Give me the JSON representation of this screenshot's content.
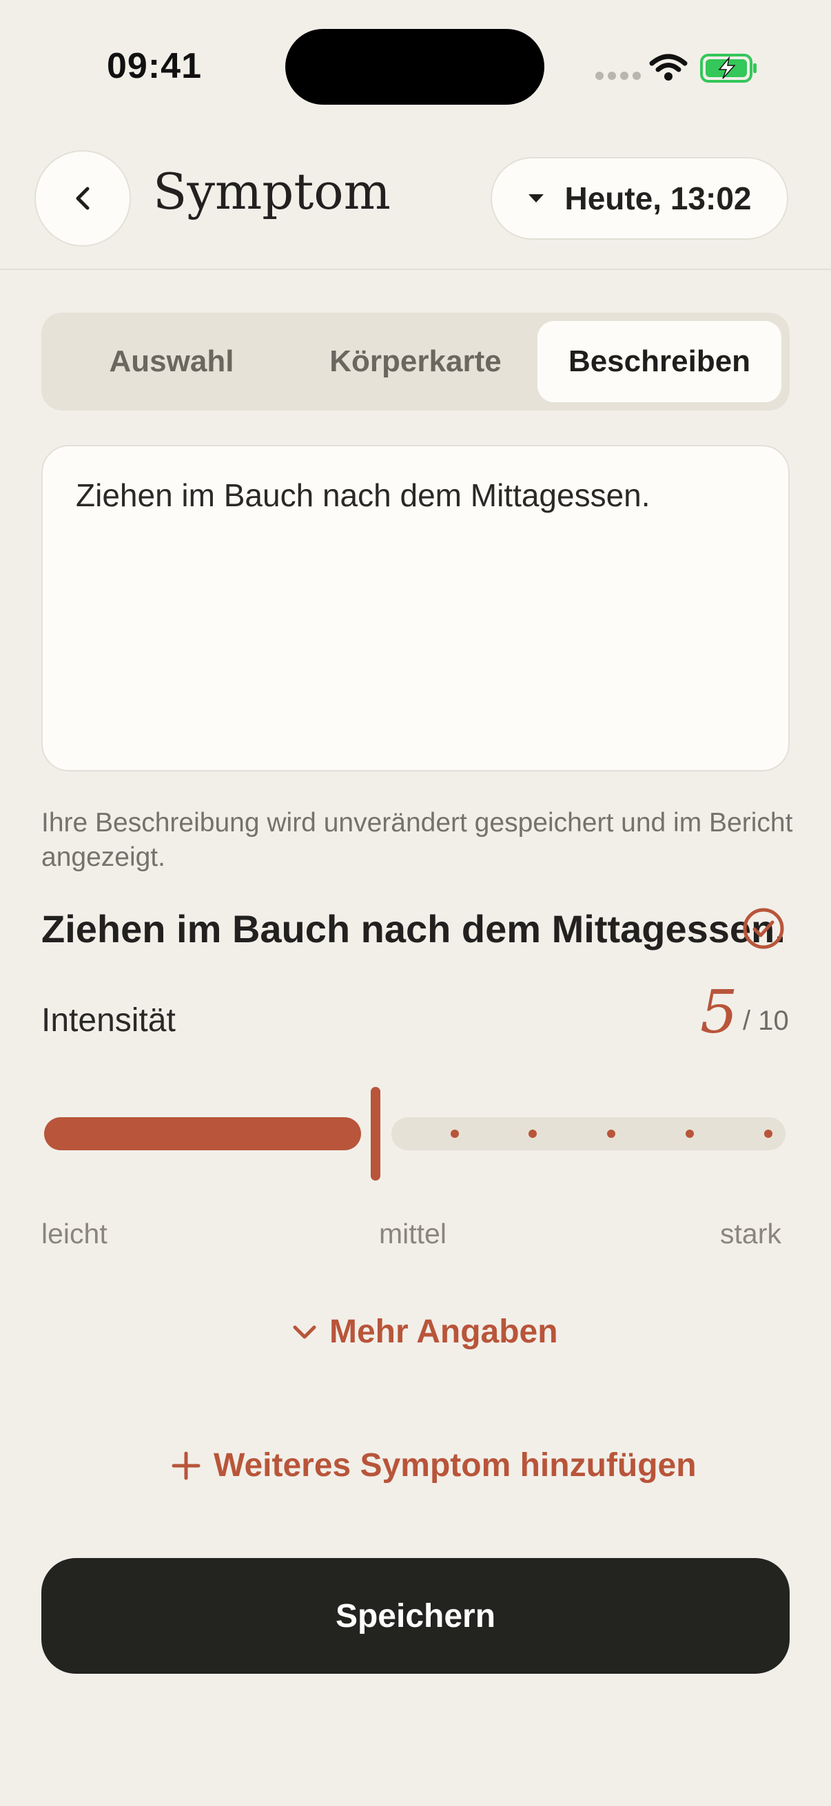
{
  "status_bar": {
    "time": "09:41"
  },
  "header": {
    "title": "Symptom",
    "date_label": "Heute, 13:02"
  },
  "tabs": [
    {
      "label": "Auswahl",
      "active": false
    },
    {
      "label": "Körperkarte",
      "active": false
    },
    {
      "label": "Beschreiben",
      "active": true
    }
  ],
  "description": {
    "value": "Ziehen im Bauch nach dem Mittagessen.",
    "hint": "Ihre Beschreibung wird unverändert gespeichert und im Bericht angezeigt."
  },
  "summary": {
    "text": "Ziehen im Bauch nach dem Mittagessen."
  },
  "intensity": {
    "label": "Intensität",
    "value": "5",
    "max_label": "/ 10",
    "scale_low": "leicht",
    "scale_mid": "mittel",
    "scale_high": "stark"
  },
  "more_details_label": "Mehr Angaben",
  "add_symptom_label": "Weiteres Symptom hinzufügen",
  "save_label": "Speichern",
  "colors": {
    "accent": "#b8553a",
    "background": "#f2efe9",
    "button_dark": "#232320"
  }
}
